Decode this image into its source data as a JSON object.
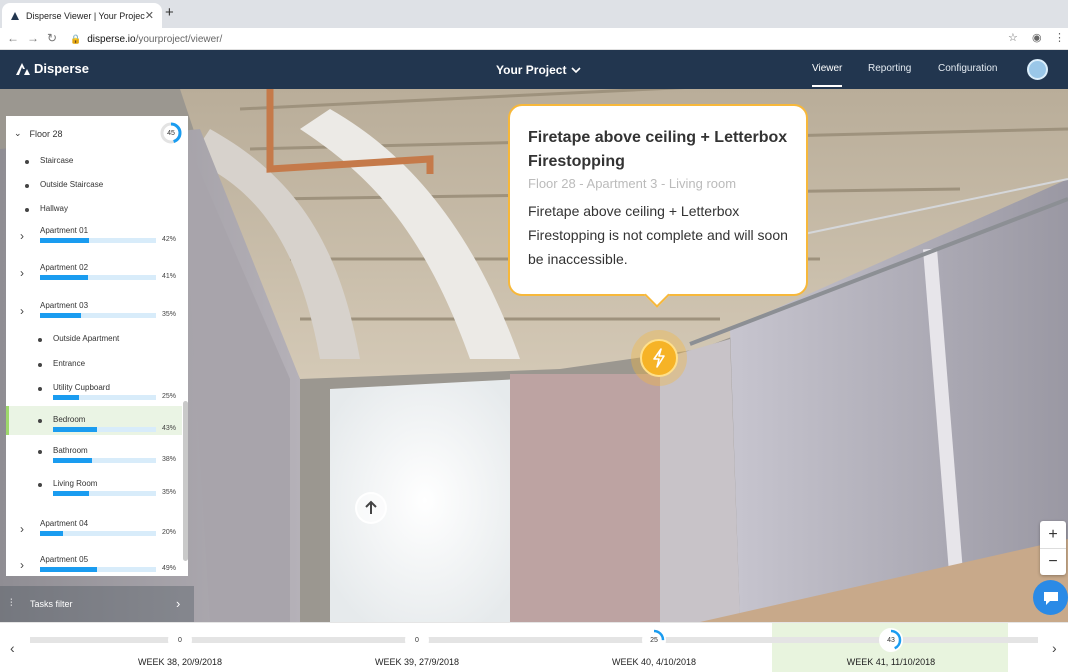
{
  "browser": {
    "tab_title": "Disperse Viewer | Your Project",
    "url_domain": "disperse.io",
    "url_path": "/yourproject/viewer/"
  },
  "app": {
    "logo": "Disperse",
    "project": "Your Project",
    "nav": [
      "Viewer",
      "Reporting",
      "Configuration"
    ],
    "active_nav": "Viewer"
  },
  "sidebar": {
    "floor": "Floor 28",
    "floor_progress": 45,
    "items": [
      {
        "label": "Staircase",
        "type": "bullet"
      },
      {
        "label": "Outside Staircase",
        "type": "bullet"
      },
      {
        "label": "Hallway",
        "type": "bullet"
      },
      {
        "label": "Apartment 01",
        "type": "group",
        "pct": "42%",
        "value": 42
      },
      {
        "label": "Apartment 02",
        "type": "group",
        "pct": "41%",
        "value": 41
      },
      {
        "label": "Apartment 03",
        "type": "group",
        "pct": "35%",
        "value": 35
      },
      {
        "label": "Outside Apartment",
        "type": "sub"
      },
      {
        "label": "Entrance",
        "type": "sub"
      },
      {
        "label": "Utility Cupboard",
        "type": "sub",
        "pct": "25%",
        "value": 25
      },
      {
        "label": "Bedroom",
        "type": "sub",
        "pct": "43%",
        "value": 43,
        "selected": true
      },
      {
        "label": "Bathroom",
        "type": "sub",
        "pct": "38%",
        "value": 38
      },
      {
        "label": "Living Room",
        "type": "sub",
        "pct": "35%",
        "value": 35
      },
      {
        "label": "Apartment 04",
        "type": "group",
        "pct": "20%",
        "value": 20
      },
      {
        "label": "Apartment 05",
        "type": "group",
        "pct": "49%",
        "value": 49
      }
    ],
    "tasks_filter": "Tasks filter"
  },
  "tooltip": {
    "title": "Firetape above ceiling + Letterbox Firestopping",
    "location": "Floor 28 - Apartment 3 - Living room",
    "body": "Firetape above ceiling + Letterbox Firestopping is not complete and will soon be inaccessible."
  },
  "timeline": {
    "weeks": [
      {
        "label": "WEEK 38, 20/9/2018",
        "value": "0"
      },
      {
        "label": "WEEK 39, 27/9/2018",
        "value": "0"
      },
      {
        "label": "WEEK 40, 4/10/2018",
        "value": "25"
      },
      {
        "label": "WEEK 41, 11/10/2018",
        "value": "43"
      }
    ]
  },
  "colors": {
    "header": "#22364f",
    "accent": "#1a9cf0",
    "warning": "#f6b326",
    "selected_bg": "#eaf4e4"
  }
}
